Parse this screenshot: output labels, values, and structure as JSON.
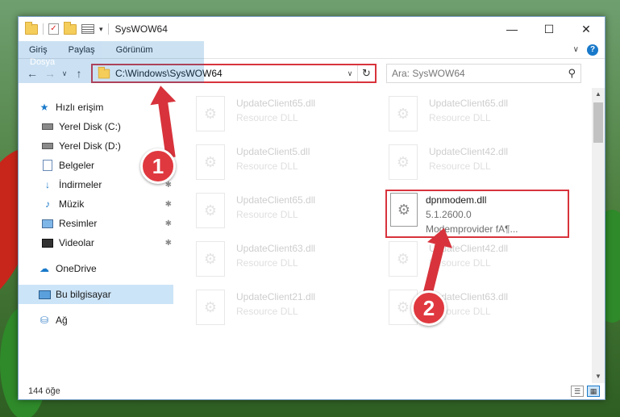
{
  "titlebar": {
    "title": "SysWOW64",
    "minimize": "—",
    "maximize": "☐",
    "close": "✕"
  },
  "ribbon": {
    "tabs": [
      "Dosya",
      "Giriş",
      "Paylaş",
      "Görünüm"
    ],
    "chevron": "∨",
    "help": "?"
  },
  "nav": {
    "back": "←",
    "forward": "→",
    "recent": "∨",
    "up": "↑",
    "address": "C:\\Windows\\SysWOW64",
    "address_dropdown": "∨",
    "refresh": "↻",
    "search_placeholder": "Ara: SysWOW64",
    "search_icon": "⚲"
  },
  "sidebar": {
    "items": [
      {
        "label": "Hızlı erişim",
        "icon": "star-icon"
      },
      {
        "label": "Yerel Disk (C:)",
        "icon": "disk-icon",
        "pinned": true
      },
      {
        "label": "Yerel Disk (D:)",
        "icon": "disk-icon",
        "pinned": true
      },
      {
        "label": "Belgeler",
        "icon": "documents-icon",
        "pinned": true
      },
      {
        "label": "İndirmeler",
        "icon": "downloads-icon",
        "pinned": true
      },
      {
        "label": "Müzik",
        "icon": "music-icon",
        "pinned": true
      },
      {
        "label": "Resimler",
        "icon": "pictures-icon",
        "pinned": true
      },
      {
        "label": "Videolar",
        "icon": "videos-icon",
        "pinned": true
      },
      {
        "label": "OneDrive",
        "icon": "cloud-icon"
      },
      {
        "label": "Bu bilgisayar",
        "icon": "computer-icon",
        "selected": true
      },
      {
        "label": "Ağ",
        "icon": "network-icon"
      }
    ]
  },
  "files": {
    "faded": [
      {
        "name": "UpdateClient65.dll",
        "desc": "Resource DLL"
      },
      {
        "name": "UpdateClient65.dll",
        "desc": "Resource DLL"
      },
      {
        "name": "UpdateClient5.dll",
        "desc": "Resource DLL"
      },
      {
        "name": "UpdateClient42.dll",
        "desc": "Resource DLL"
      },
      {
        "name": "UpdateClient65.dll",
        "desc": "Resource DLL"
      },
      {
        "name": "UpdateClient63.dll",
        "desc": "Resource DLL"
      },
      {
        "name": "UpdateClient42.dll",
        "desc": "Resource DLL"
      },
      {
        "name": "UpdateClient21.dll",
        "desc": "Resource DLL"
      },
      {
        "name": "UpdateClient63.dll",
        "desc": "Resource DLL"
      }
    ],
    "highlighted": {
      "name": "dpnmodem.dll",
      "version": "5.1.2600.0",
      "desc": "Modemprovider fA¶..."
    }
  },
  "status": {
    "count": "144 öğe"
  },
  "annotations": {
    "badge1": "1",
    "badge2": "2",
    "color": "#d8333c"
  }
}
